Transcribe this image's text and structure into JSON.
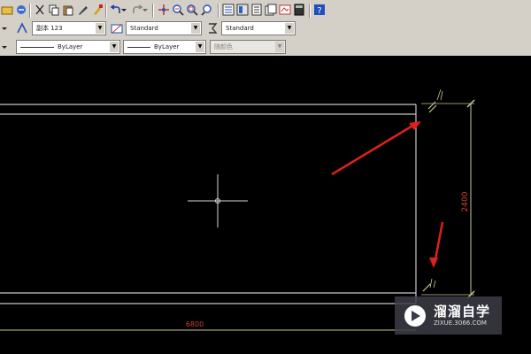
{
  "toolbar": {
    "textstyle_value": "副本 123",
    "dimstyle_value": "Standard",
    "tablestyle_value": "Standard",
    "linetype_value": "ByLayer",
    "lineweight_value": "ByLayer",
    "plotstyle_value": "随颜色"
  },
  "drawing": {
    "dim_horizontal": "6800",
    "dim_vertical": "2400"
  },
  "colors": {
    "dimension_line": "#c8c890",
    "dimension_text": "#d04030",
    "arrow": "#e0201a",
    "geometry": "#c8c8c8"
  },
  "icons": [
    "open-icon",
    "match-icon",
    "cut-icon",
    "copy-icon",
    "paste-icon",
    "brush-icon",
    "undo-icon",
    "redo-icon",
    "pan-icon",
    "zoom-realtime-icon",
    "zoom-window-icon",
    "zoom-previous-icon",
    "properties-icon",
    "design-center-icon",
    "tool-palette-icon",
    "sheet-set-icon",
    "markup-icon",
    "calculator-icon",
    "help-icon",
    "text-style-icon",
    "dim-style-icon",
    "table-style-icon"
  ],
  "watermark": {
    "title": "溜溜自学",
    "url": "ZIXUE.3066.COM"
  }
}
